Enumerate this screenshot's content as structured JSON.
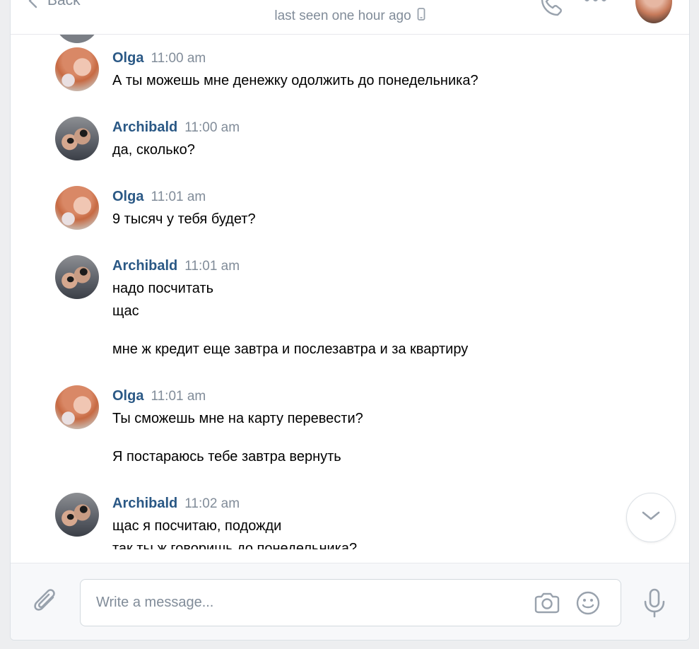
{
  "header": {
    "back_label": "Back",
    "name": "",
    "status": "last seen one hour ago"
  },
  "messages": [
    {
      "author": "Olga",
      "time": "11:00 am",
      "lines": [
        "А ты можешь мне денежку одолжить до понедельника?"
      ]
    },
    {
      "author": "Archibald",
      "time": "11:00 am",
      "lines": [
        "да, сколько?"
      ]
    },
    {
      "author": "Olga",
      "time": "11:01 am",
      "lines": [
        "9 тысяч у тебя будет?"
      ]
    },
    {
      "author": "Archibald",
      "time": "11:01 am",
      "lines": [
        "надо посчитать",
        "щас",
        "мне ж кредит еще завтра и послезавтра и за квартиру"
      ]
    },
    {
      "author": "Olga",
      "time": "11:01 am",
      "lines": [
        "Ты сможешь мне на карту перевести?",
        "Я постараюсь тебе завтра вернуть"
      ]
    },
    {
      "author": "Archibald",
      "time": "11:02 am",
      "lines": [
        "щас я посчитаю, подожди",
        "так ты ж говоришь до понедельника?"
      ]
    }
  ],
  "composer": {
    "placeholder": "Write a message..."
  },
  "colors": {
    "author": "#2a5885",
    "muted": "#818c99",
    "icon": "#99a2ad"
  },
  "icons": [
    "back-chevron-icon",
    "mobile-phone-icon",
    "phone-call-icon",
    "more-icon",
    "chevron-down-icon",
    "paperclip-icon",
    "camera-icon",
    "smile-icon",
    "microphone-icon"
  ]
}
